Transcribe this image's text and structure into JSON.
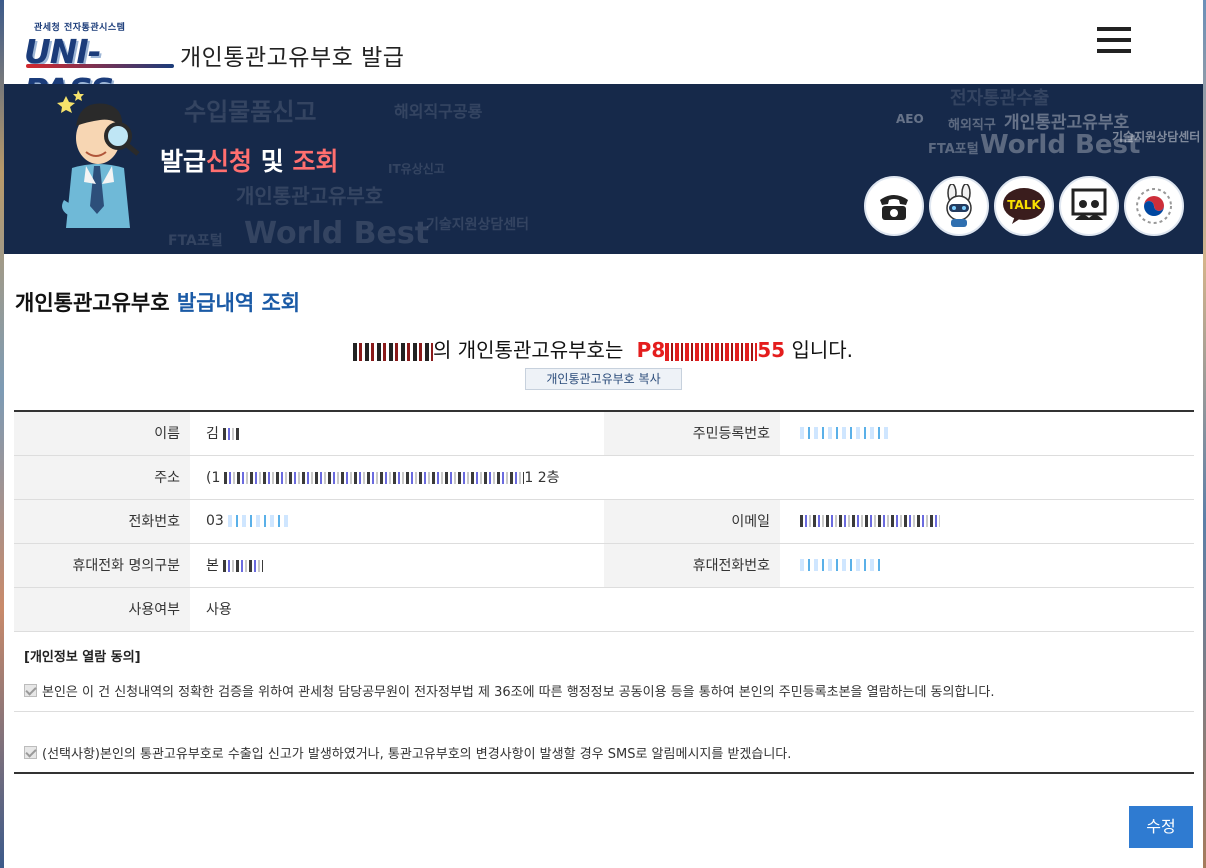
{
  "header": {
    "logo_sub": "관세청 전자통관시스템",
    "logo_main": "UNI-PASS",
    "site_title": "개인통관고유부호 발급",
    "menu_icon": "hamburger-icon"
  },
  "banner": {
    "title_part1": "발급",
    "title_part2": "신청",
    "title_part3": " 및 ",
    "title_part4": "조회",
    "background_words": [
      "수입물품신고",
      "해외직구공룡",
      "전자통관수출",
      "개인통관고유부호",
      "World Best",
      "FTA포털",
      "기술지원상담센터",
      "AEO",
      "해외직구",
      "IT유상신고"
    ],
    "icons": [
      "telephone-icon",
      "mascot-chat-icon",
      "kakao-talk-icon",
      "remote-support-icon",
      "government-emblem-icon"
    ],
    "talk_label": "TALK"
  },
  "section": {
    "title_black": "개인통관고유부호",
    "title_blue": " 발급내역 조회"
  },
  "result": {
    "suffix": "의 개인통관고유부호는",
    "code_prefix": "P8",
    "code_suffix": "55",
    "ending": "입니다.",
    "copy_button": "개인통관고유부호 복사"
  },
  "table": {
    "name_label": "이름",
    "name_value": "김",
    "rrn_label": "주민등록번호",
    "address_label": "주소",
    "address_prefix": "(1",
    "address_suffix": "1 2층",
    "phone_label": "전화번호",
    "phone_value": "03",
    "email_label": "이메일",
    "mobile_owner_label": "휴대전화 명의구분",
    "mobile_owner_value": "본",
    "mobile_label": "휴대전화번호",
    "use_label": "사용여부",
    "use_value": "사용"
  },
  "consent": {
    "title": "[개인정보 열람 동의]",
    "item1": "본인은 이 건 신청내역의 정확한 검증을 위하여 관세청 담당공무원이 전자정부법 제 36조에 따른 행정정보 공동이용 등을 통하여 본인의 주민등록초본을 열람하는데 동의합니다.",
    "item2": "(선택사항)본인의 통관고유부호로 수출입 신고가 발생하였거나, 통관고유부호의 변경사항이 발생할 경우 SMS로 알림메시지를 받겠습니다."
  },
  "actions": {
    "edit_button": "수정"
  }
}
